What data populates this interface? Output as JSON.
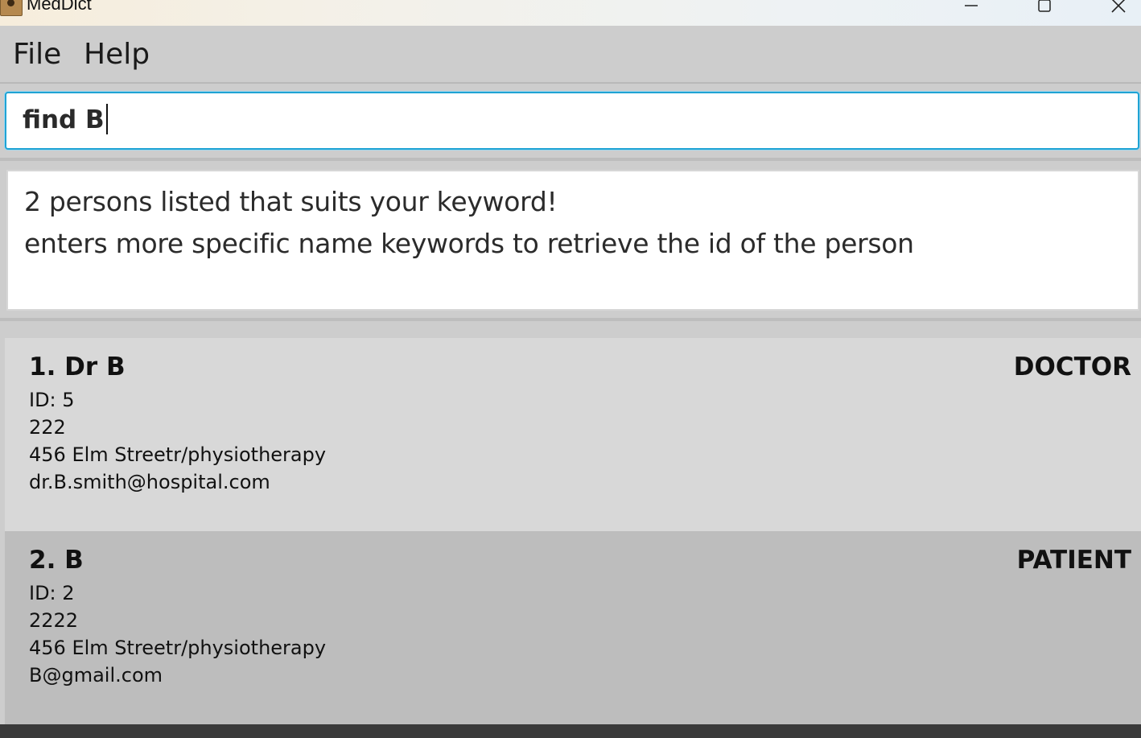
{
  "window": {
    "title": "MedDict",
    "controls": [
      "minimize-icon",
      "maximize-icon",
      "close-icon"
    ]
  },
  "menu": {
    "file": "File",
    "help": "Help"
  },
  "command": {
    "value": "find B"
  },
  "result": {
    "line1": "2 persons listed that suits your keyword!",
    "line2": "enters more specific name keywords to retrieve the id of the person"
  },
  "persons": [
    {
      "name": "1. Dr B",
      "role": "DOCTOR",
      "id": "ID: 5",
      "phone": "222",
      "address": "456 Elm Streetr/physiotherapy",
      "email": "dr.B.smith@hospital.com"
    },
    {
      "name": "2. B",
      "role": "PATIENT",
      "id": "ID: 2",
      "phone": "2222",
      "address": "456 Elm Streetr/physiotherapy",
      "email": "B@gmail.com"
    }
  ],
  "colors": {
    "card_primary": "#d8d8d8",
    "card_alt": "#bdbdbd",
    "focus_border": "#1fa3d4"
  }
}
